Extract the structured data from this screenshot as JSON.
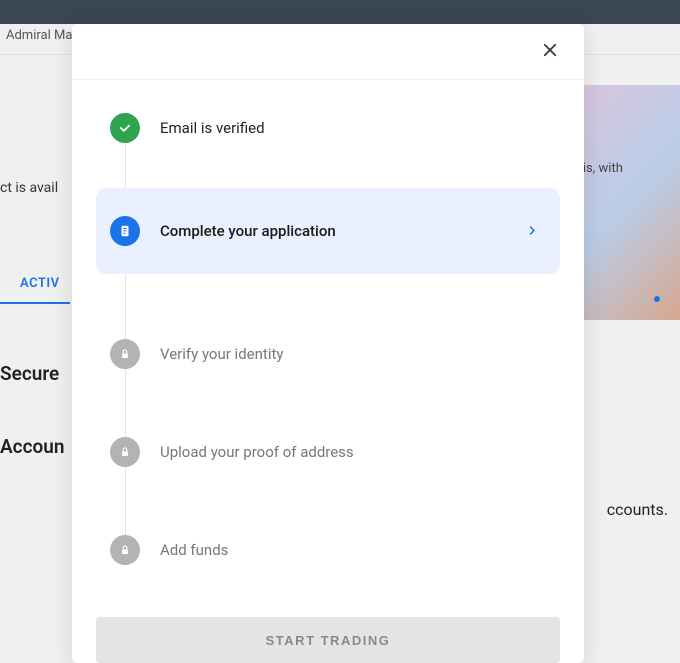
{
  "background": {
    "brand": "Admiral Mar",
    "text1": "ct is avail",
    "side_text": "ysis, with",
    "tab": "ACTIV",
    "heading1": "Secure",
    "heading2": "Accoun",
    "message": "ccounts."
  },
  "modal": {
    "close_label": "Close",
    "steps": [
      {
        "icon": "check",
        "label": "Email is verified",
        "state": "done"
      },
      {
        "icon": "doc",
        "label": "Complete your application",
        "state": "active"
      },
      {
        "icon": "lock",
        "label": "Verify your identity",
        "state": "locked"
      },
      {
        "icon": "lock",
        "label": "Upload your proof of address",
        "state": "locked"
      },
      {
        "icon": "lock",
        "label": "Add funds",
        "state": "locked"
      }
    ],
    "cta": "START TRADING"
  }
}
